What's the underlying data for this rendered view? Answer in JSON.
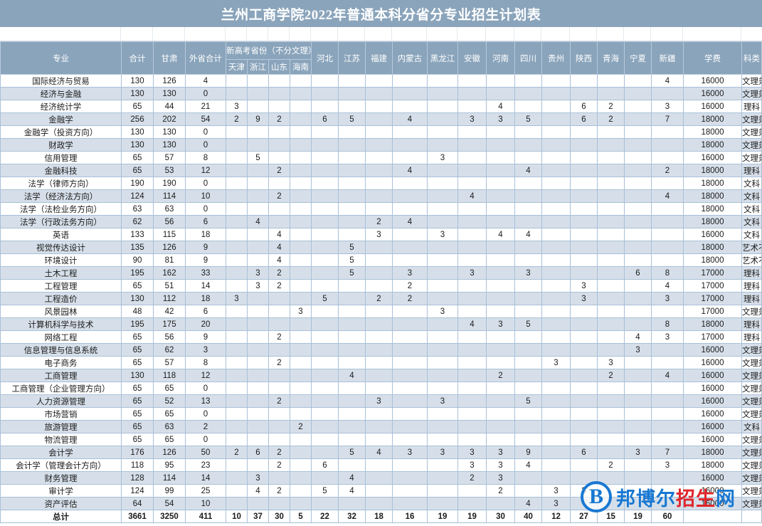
{
  "title": "兰州工商学院2022年普通本科分省分专业招生计划表",
  "watermark": {
    "badge": "B",
    "part1": "邦博尔",
    "part2": "招生",
    "part3": "网"
  },
  "header": {
    "major": "专业",
    "total": "合计",
    "gansu": "甘肃",
    "outside_total": "外省合计",
    "newgaokao_group": "新高考省份（不分文理）",
    "newgaokao": [
      "天津",
      "浙江",
      "山东",
      "海南"
    ],
    "provinces": [
      "河北",
      "江苏",
      "福建",
      "内蒙古",
      "黑龙江",
      "安徽",
      "河南",
      "四川",
      "贵州",
      "陕西",
      "青海",
      "宁夏",
      "新疆"
    ],
    "tuition": "学费",
    "category": "科类"
  },
  "rows": [
    {
      "major": "国际经济与贸易",
      "total": "130",
      "gansu": "126",
      "outside": "4",
      "cells": [
        "",
        "",
        "",
        "",
        "",
        "",
        "",
        "",
        "",
        "",
        "",
        "",
        "",
        "",
        "",
        "",
        "4"
      ],
      "tuition": "16000",
      "category": "文理兼收"
    },
    {
      "major": "经济与金融",
      "total": "130",
      "gansu": "130",
      "outside": "0",
      "cells": [
        "",
        "",
        "",
        "",
        "",
        "",
        "",
        "",
        "",
        "",
        "",
        "",
        "",
        "",
        "",
        "",
        ""
      ],
      "tuition": "16000",
      "category": "文理兼收"
    },
    {
      "major": "经济统计学",
      "total": "65",
      "gansu": "44",
      "outside": "21",
      "cells": [
        "3",
        "",
        "",
        "",
        "",
        "",
        "",
        "",
        "",
        "",
        "4",
        "",
        "",
        "6",
        "2",
        "",
        "3"
      ],
      "tuition": "16000",
      "category": "理科"
    },
    {
      "major": "金融学",
      "total": "256",
      "gansu": "202",
      "outside": "54",
      "cells": [
        "2",
        "9",
        "2",
        "",
        "6",
        "5",
        "",
        "4",
        "",
        "3",
        "3",
        "5",
        "",
        "6",
        "2",
        "",
        "7"
      ],
      "tuition": "18000",
      "category": "文理兼收"
    },
    {
      "major": "金融学（投资方向）",
      "total": "130",
      "gansu": "130",
      "outside": "0",
      "cells": [
        "",
        "",
        "",
        "",
        "",
        "",
        "",
        "",
        "",
        "",
        "",
        "",
        "",
        "",
        "",
        "",
        ""
      ],
      "tuition": "18000",
      "category": "文理兼收"
    },
    {
      "major": "财政学",
      "total": "130",
      "gansu": "130",
      "outside": "0",
      "cells": [
        "",
        "",
        "",
        "",
        "",
        "",
        "",
        "",
        "",
        "",
        "",
        "",
        "",
        "",
        "",
        "",
        ""
      ],
      "tuition": "18000",
      "category": "文理兼收"
    },
    {
      "major": "信用管理",
      "total": "65",
      "gansu": "57",
      "outside": "8",
      "cells": [
        "",
        "5",
        "",
        "",
        "",
        "",
        "",
        "",
        "3",
        "",
        "",
        "",
        "",
        "",
        "",
        "",
        ""
      ],
      "tuition": "16000",
      "category": "文理兼收"
    },
    {
      "major": "金融科技",
      "total": "65",
      "gansu": "53",
      "outside": "12",
      "cells": [
        "",
        "",
        "2",
        "",
        "",
        "",
        "",
        "4",
        "",
        "",
        "",
        "4",
        "",
        "",
        "",
        "",
        "2"
      ],
      "tuition": "18000",
      "category": "理科"
    },
    {
      "major": "法学（律师方向）",
      "total": "190",
      "gansu": "190",
      "outside": "0",
      "cells": [
        "",
        "",
        "",
        "",
        "",
        "",
        "",
        "",
        "",
        "",
        "",
        "",
        "",
        "",
        "",
        "",
        ""
      ],
      "tuition": "18000",
      "category": "文科"
    },
    {
      "major": "法学（经济法方向）",
      "total": "124",
      "gansu": "114",
      "outside": "10",
      "cells": [
        "",
        "",
        "2",
        "",
        "",
        "",
        "",
        "",
        "",
        "4",
        "",
        "",
        "",
        "",
        "",
        "",
        "4"
      ],
      "tuition": "18000",
      "category": "文科"
    },
    {
      "major": "法学（法检业务方向）",
      "total": "63",
      "gansu": "63",
      "outside": "0",
      "cells": [
        "",
        "",
        "",
        "",
        "",
        "",
        "",
        "",
        "",
        "",
        "",
        "",
        "",
        "",
        "",
        "",
        ""
      ],
      "tuition": "18000",
      "category": "文科"
    },
    {
      "major": "法学（行政法务方向）",
      "total": "62",
      "gansu": "56",
      "outside": "6",
      "cells": [
        "",
        "4",
        "",
        "",
        "",
        "",
        "2",
        "4",
        "",
        "",
        "",
        "",
        "",
        "",
        "",
        "",
        ""
      ],
      "tuition": "18000",
      "category": "文科"
    },
    {
      "major": "英语",
      "total": "133",
      "gansu": "115",
      "outside": "18",
      "cells": [
        "",
        "",
        "4",
        "",
        "",
        "",
        "3",
        "",
        "3",
        "",
        "4",
        "4",
        "",
        "",
        "",
        "",
        ""
      ],
      "tuition": "16000",
      "category": "文科"
    },
    {
      "major": "视觉传达设计",
      "total": "135",
      "gansu": "126",
      "outside": "9",
      "cells": [
        "",
        "",
        "4",
        "",
        "",
        "5",
        "",
        "",
        "",
        "",
        "",
        "",
        "",
        "",
        "",
        "",
        ""
      ],
      "tuition": "18000",
      "category": "艺术不分文理"
    },
    {
      "major": "环境设计",
      "total": "90",
      "gansu": "81",
      "outside": "9",
      "cells": [
        "",
        "",
        "4",
        "",
        "",
        "5",
        "",
        "",
        "",
        "",
        "",
        "",
        "",
        "",
        "",
        "",
        ""
      ],
      "tuition": "18000",
      "category": "艺术不分文理"
    },
    {
      "major": "土木工程",
      "total": "195",
      "gansu": "162",
      "outside": "33",
      "cells": [
        "",
        "3",
        "2",
        "",
        "",
        "5",
        "",
        "3",
        "",
        "3",
        "",
        "3",
        "",
        "",
        "",
        "6",
        "8"
      ],
      "tuition": "17000",
      "category": "理科"
    },
    {
      "major": "工程管理",
      "total": "65",
      "gansu": "51",
      "outside": "14",
      "cells": [
        "",
        "3",
        "2",
        "",
        "",
        "",
        "",
        "2",
        "",
        "",
        "",
        "",
        "",
        "3",
        "",
        "",
        "4"
      ],
      "tuition": "17000",
      "category": "理科"
    },
    {
      "major": "工程造价",
      "total": "130",
      "gansu": "112",
      "outside": "18",
      "cells": [
        "3",
        "",
        "",
        "",
        "5",
        "",
        "2",
        "2",
        "",
        "",
        "",
        "",
        "",
        "3",
        "",
        "",
        "3"
      ],
      "tuition": "17000",
      "category": "理科"
    },
    {
      "major": "风景园林",
      "total": "48",
      "gansu": "42",
      "outside": "6",
      "cells": [
        "",
        "",
        "",
        "3",
        "",
        "",
        "",
        "",
        "3",
        "",
        "",
        "",
        "",
        "",
        "",
        "",
        ""
      ],
      "tuition": "17000",
      "category": "文理兼收"
    },
    {
      "major": "计算机科学与技术",
      "total": "195",
      "gansu": "175",
      "outside": "20",
      "cells": [
        "",
        "",
        "",
        "",
        "",
        "",
        "",
        "",
        "",
        "4",
        "3",
        "5",
        "",
        "",
        "",
        "",
        "8"
      ],
      "tuition": "18000",
      "category": "理科"
    },
    {
      "major": "网络工程",
      "total": "65",
      "gansu": "56",
      "outside": "9",
      "cells": [
        "",
        "",
        "2",
        "",
        "",
        "",
        "",
        "",
        "",
        "",
        "",
        "",
        "",
        "",
        "",
        "4",
        "3"
      ],
      "tuition": "17000",
      "category": "理科"
    },
    {
      "major": "信息管理与信息系统",
      "total": "65",
      "gansu": "62",
      "outside": "3",
      "cells": [
        "",
        "",
        "",
        "",
        "",
        "",
        "",
        "",
        "",
        "",
        "",
        "",
        "",
        "",
        "",
        "3",
        ""
      ],
      "tuition": "16000",
      "category": "文理兼收"
    },
    {
      "major": "电子商务",
      "total": "65",
      "gansu": "57",
      "outside": "8",
      "cells": [
        "",
        "",
        "2",
        "",
        "",
        "",
        "",
        "",
        "",
        "",
        "",
        "",
        "3",
        "",
        "3",
        "",
        ""
      ],
      "tuition": "16000",
      "category": "文理兼收"
    },
    {
      "major": "工商管理",
      "total": "130",
      "gansu": "118",
      "outside": "12",
      "cells": [
        "",
        "",
        "",
        "",
        "",
        "4",
        "",
        "",
        "",
        "",
        "2",
        "",
        "",
        "",
        "2",
        "",
        "4"
      ],
      "tuition": "16000",
      "category": "文理兼收"
    },
    {
      "major": "工商管理（企业管理方向）",
      "total": "65",
      "gansu": "65",
      "outside": "0",
      "cells": [
        "",
        "",
        "",
        "",
        "",
        "",
        "",
        "",
        "",
        "",
        "",
        "",
        "",
        "",
        "",
        "",
        ""
      ],
      "tuition": "16000",
      "category": "文理兼收"
    },
    {
      "major": "人力资源管理",
      "total": "65",
      "gansu": "52",
      "outside": "13",
      "cells": [
        "",
        "",
        "2",
        "",
        "",
        "",
        "3",
        "",
        "3",
        "",
        "",
        "5",
        "",
        "",
        "",
        "",
        ""
      ],
      "tuition": "16000",
      "category": "文理兼收"
    },
    {
      "major": "市场营销",
      "total": "65",
      "gansu": "65",
      "outside": "0",
      "cells": [
        "",
        "",
        "",
        "",
        "",
        "",
        "",
        "",
        "",
        "",
        "",
        "",
        "",
        "",
        "",
        "",
        ""
      ],
      "tuition": "16000",
      "category": "文理兼收"
    },
    {
      "major": "旅游管理",
      "total": "65",
      "gansu": "63",
      "outside": "2",
      "cells": [
        "",
        "",
        "",
        "2",
        "",
        "",
        "",
        "",
        "",
        "",
        "",
        "",
        "",
        "",
        "",
        "",
        ""
      ],
      "tuition": "16000",
      "category": "文科"
    },
    {
      "major": "物流管理",
      "total": "65",
      "gansu": "65",
      "outside": "0",
      "cells": [
        "",
        "",
        "",
        "",
        "",
        "",
        "",
        "",
        "",
        "",
        "",
        "",
        "",
        "",
        "",
        "",
        ""
      ],
      "tuition": "16000",
      "category": "文理兼收"
    },
    {
      "major": "会计学",
      "total": "176",
      "gansu": "126",
      "outside": "50",
      "cells": [
        "2",
        "6",
        "2",
        "",
        "",
        "5",
        "4",
        "3",
        "3",
        "3",
        "3",
        "9",
        "",
        "6",
        "",
        "3",
        "7"
      ],
      "tuition": "18000",
      "category": "文理兼收"
    },
    {
      "major": "会计学（管理会计方向）",
      "total": "118",
      "gansu": "95",
      "outside": "23",
      "cells": [
        "",
        "",
        "2",
        "",
        "6",
        "",
        "",
        "",
        "",
        "3",
        "3",
        "4",
        "",
        "",
        "2",
        "",
        "3"
      ],
      "tuition": "18000",
      "category": "文理兼收"
    },
    {
      "major": "财务管理",
      "total": "128",
      "gansu": "114",
      "outside": "14",
      "cells": [
        "",
        "3",
        "",
        "",
        "",
        "4",
        "",
        "",
        "",
        "2",
        "3",
        "",
        "",
        "",
        "",
        "",
        ""
      ],
      "tuition": "16000",
      "category": "文理兼收"
    },
    {
      "major": "审计学",
      "total": "124",
      "gansu": "99",
      "outside": "25",
      "cells": [
        "",
        "4",
        "2",
        "",
        "5",
        "4",
        "",
        "",
        "",
        "",
        "2",
        "",
        "3",
        "3",
        "",
        "",
        ""
      ],
      "tuition": "16000",
      "category": "文理兼收"
    },
    {
      "major": "资产评估",
      "total": "64",
      "gansu": "54",
      "outside": "10",
      "cells": [
        "",
        "",
        "",
        "",
        "",
        "",
        "",
        "",
        "",
        "",
        "",
        "4",
        "3",
        "",
        "",
        "",
        ""
      ],
      "tuition": "16000",
      "category": "文理兼收"
    }
  ],
  "total_row": {
    "major": "总计",
    "total": "3661",
    "gansu": "3250",
    "outside": "411",
    "cells": [
      "10",
      "37",
      "30",
      "5",
      "22",
      "32",
      "18",
      "16",
      "19",
      "19",
      "30",
      "40",
      "12",
      "27",
      "15",
      "19",
      "60"
    ],
    "tuition": "",
    "category": ""
  }
}
